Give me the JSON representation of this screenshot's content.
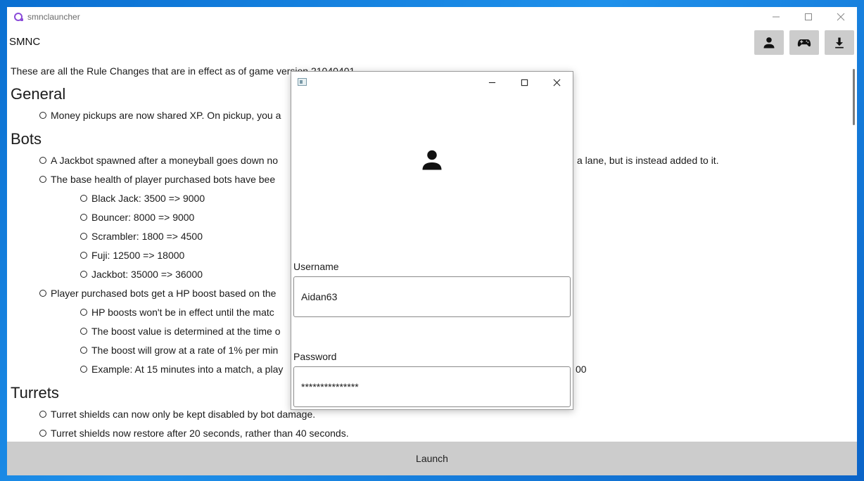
{
  "window": {
    "title": "smnclauncher"
  },
  "header": {
    "brand": "SMNC"
  },
  "toolbar": {
    "icons": [
      "user-icon",
      "gamepad-icon",
      "download-icon"
    ]
  },
  "content": {
    "intro": "These are all the Rule Changes that are in effect as of game version 21040401",
    "sections": [
      {
        "title": "General",
        "items": [
          "Money pickups are now shared XP. On pickup, you a"
        ]
      },
      {
        "title": "Bots",
        "items": [
          "A Jackbot spawned after a moneyball goes down no",
          "a lane, but is instead added to it.",
          "The base health of player purchased bots have bee",
          "Black Jack: 3500 => 9000",
          "Bouncer: 8000 => 9000",
          "Scrambler: 1800 => 4500",
          "Fuji: 12500 => 18000",
          "Jackbot: 35000 => 36000",
          "Player purchased bots get a HP boost based on the",
          "HP boosts won't be in effect until the matc",
          "The boost value is determined at the time o",
          "The boost will grow at a rate of 1% per min",
          "Example: At 15 minutes into a match, a play",
          "00"
        ]
      },
      {
        "title": "Turrets",
        "items": [
          "Turret shields can now only be kept disabled by bot damage.",
          "Turret shields now restore after 20 seconds, rather than 40 seconds."
        ]
      }
    ]
  },
  "footer": {
    "launch_label": "Launch"
  },
  "login_dialog": {
    "username_label": "Username",
    "username_value": "Aidan63",
    "password_label": "Password",
    "password_value": "***************"
  }
}
